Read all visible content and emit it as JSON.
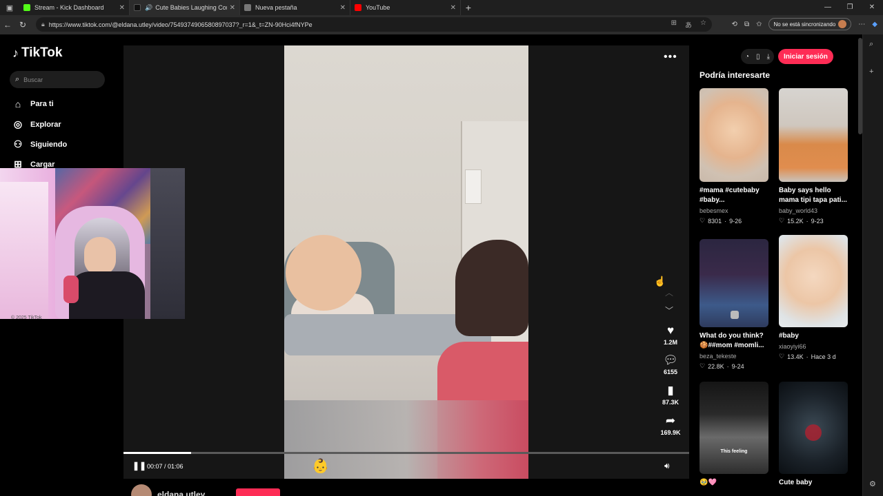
{
  "browser": {
    "tabs": [
      {
        "title": "Stream - Kick Dashboard",
        "fav_color": "#53fc18",
        "active": false
      },
      {
        "title": "Cute Babies Laughing Comp",
        "fav_color": "#111111",
        "active": true
      },
      {
        "title": "Nueva pestaña",
        "fav_color": "#777777",
        "active": false
      },
      {
        "title": "YouTube",
        "fav_color": "#ff0000",
        "active": false
      }
    ],
    "url": "https://www.tiktok.com/@eldana.utley/video/7549374906580897037?_r=1&_t=ZN-90Hci4fNYPe",
    "sync_label": "No se está sincronizando"
  },
  "sidebar": {
    "logo": "TikTok",
    "search_placeholder": "Buscar",
    "items": [
      {
        "label": "Para ti",
        "icon": "home-icon"
      },
      {
        "label": "Explorar",
        "icon": "compass-icon"
      },
      {
        "label": "Siguiendo",
        "icon": "following-icon"
      },
      {
        "label": "Cargar",
        "icon": "upload-icon"
      }
    ],
    "footer_text": "© 2025 TikTok"
  },
  "video": {
    "time": "00:07 / 01:06",
    "progress_fraction": 0.12,
    "author": "eldana.utley",
    "actions": {
      "likes": "1.2M",
      "comments": "6155",
      "saves": "87.3K",
      "shares": "169.9K"
    }
  },
  "right": {
    "login_label": "Iniciar sesión",
    "title": "Podría interesarte",
    "cards": [
      {
        "caption1": "#mama #cutebaby",
        "caption2": "#baby...",
        "user": "bebesmex",
        "likes": "8301",
        "date": "9-26"
      },
      {
        "caption1": "Baby says hello",
        "caption2": "mama tipi tapa pati...",
        "user": "baby_world43",
        "likes": "15.2K",
        "date": "9-23"
      },
      {
        "caption1": "What do you think?",
        "caption2": "🍪##mom #momli...",
        "user": "beza_tekeste",
        "likes": "22.8K",
        "date": "9-24"
      },
      {
        "caption1": "#baby",
        "caption2": "",
        "user": "xiaoyiyi66",
        "likes": "13.4K",
        "date": "Hace 3 d"
      },
      {
        "caption1": "🥹🩷",
        "caption2": "",
        "user": "",
        "likes": "",
        "date": "",
        "overlay": "This feeling"
      },
      {
        "caption1": "Cute baby",
        "caption2": "",
        "user": "",
        "likes": "",
        "date": ""
      }
    ]
  }
}
